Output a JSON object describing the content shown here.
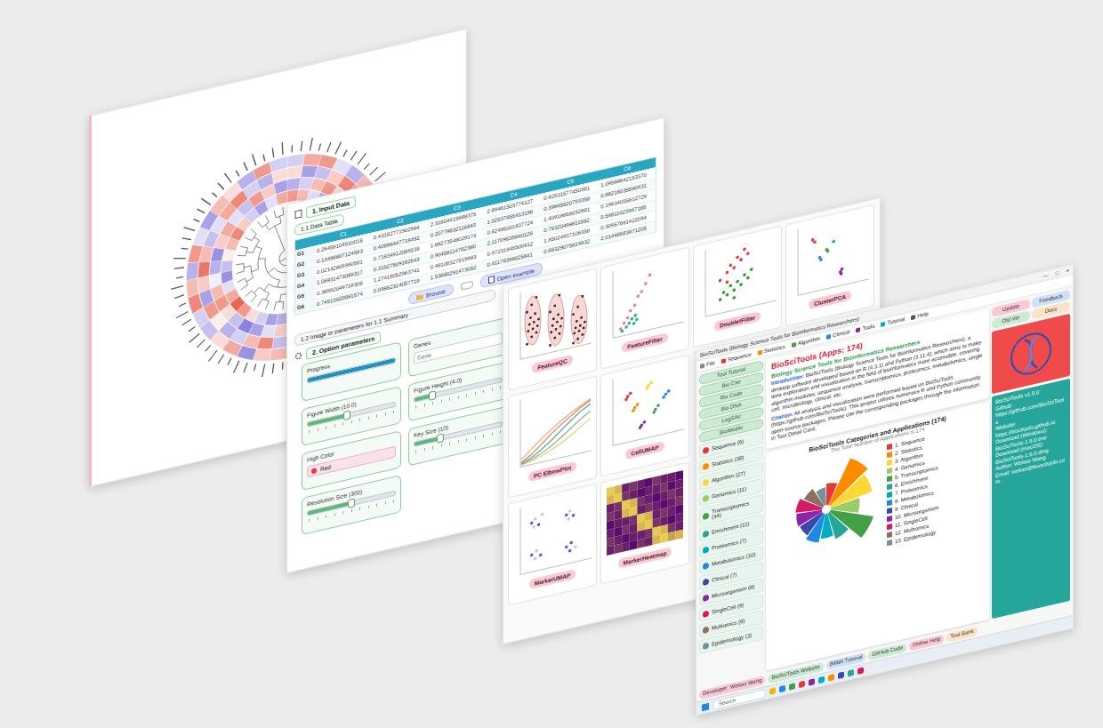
{
  "heatmap_window": {
    "rings": [
      [
        0.6,
        0.4,
        -0.2,
        -0.5,
        -0.7,
        -0.3,
        0.1,
        0.5,
        0.8,
        0.6,
        -0.4,
        -0.6,
        -0.8,
        -0.2,
        0.3,
        0.7,
        0.4,
        -0.1,
        -0.5,
        -0.6,
        -0.3,
        0.2,
        0.6,
        0.9,
        0.5,
        -0.2,
        -0.7,
        -0.4,
        0.1,
        0.4,
        0.7,
        0.3,
        -0.3,
        -0.6,
        -0.2,
        0.5
      ],
      [
        -0.5,
        -0.3,
        0.4,
        0.6,
        0.2,
        -0.4,
        -0.7,
        -0.5,
        0.3,
        0.5,
        0.7,
        0.2,
        -0.3,
        -0.6,
        -0.4,
        0.1,
        0.5,
        0.8,
        0.3,
        -0.2,
        -0.6,
        -0.8,
        -0.4,
        0.2,
        0.6,
        0.4,
        -0.1,
        -0.5,
        -0.7,
        0.3,
        0.5,
        -0.2,
        -0.4,
        0.6,
        0.3,
        -0.6
      ],
      [
        0.2,
        -0.6,
        -0.4,
        0.3,
        0.7,
        0.5,
        -0.2,
        -0.4,
        -0.6,
        0.4,
        0.2,
        -0.5,
        0.6,
        0.3,
        -0.7,
        -0.3,
        0.2,
        0.5,
        -0.4,
        0.7,
        0.4,
        -0.3,
        -0.5,
        0.1,
        0.6,
        -0.6,
        0.3,
        0.8,
        0.4,
        -0.4,
        -0.2,
        0.5,
        0.7,
        -0.3,
        -0.5,
        0.2
      ],
      [
        -0.3,
        0.5,
        0.6,
        -0.2,
        -0.5,
        0.4,
        0.3,
        -0.6,
        -0.2,
        0.7,
        -0.4,
        0.3,
        0.5,
        -0.6,
        -0.3,
        0.6,
        -0.5,
        -0.2,
        0.4,
        0.3,
        -0.7,
        0.5,
        0.2,
        -0.4,
        -0.3,
        0.7,
        0.4,
        -0.5,
        0.6,
        -0.2,
        -0.6,
        0.4,
        0.2,
        -0.5,
        0.6,
        -0.3
      ]
    ]
  },
  "data_window": {
    "section1": "1. Input Data",
    "subsection": "1.1 Data Table",
    "table": {
      "columns": [
        "C1",
        "C2",
        "C3",
        "C4",
        "C5",
        "C6"
      ],
      "rows": [
        {
          "name": "G1",
          "cells": [
            "0.28458104510016",
            "0.43182771902984",
            "2.31604419988375",
            "2.69461503774127",
            "0.82531577450361",
            "1.09588642153370"
          ]
        },
        {
          "name": "G2",
          "cells": [
            "0.13498807124563",
            "0.40898447718492",
            "0.20779632116843",
            "1.02637855413196",
            "0.39845520793358",
            "0.86216035590431"
          ]
        },
        {
          "name": "G3",
          "cells": [
            "0.02142805990561",
            "0.71834912065539",
            "1.68273548029174",
            "0.62495001837724",
            "1.40918856032861",
            "0.19834055612729"
          ]
        },
        {
          "name": "G4",
          "cells": [
            "1.06931473089317",
            "0.31527509182643",
            "0.90458114762380",
            "2.11709635840128",
            "0.75320498811562",
            "0.54811023947165"
          ]
        },
        {
          "name": "G5",
          "cells": [
            "0.36592049718306",
            "1.27418052963741",
            "0.48106327519983",
            "0.97231845500612",
            "1.85024937106358",
            "0.30957681422094"
          ]
        },
        {
          "name": "G6",
          "cells": [
            "0.74513920681574",
            "0.09862314057719",
            "1.53680291473052",
            "0.41176398025841",
            "0.66329075814932",
            "2.01448563971205"
          ]
        }
      ]
    },
    "buttons": [
      "Browse",
      "Open example"
    ],
    "summary_bar": "1.2 Image or parameters for 1.1 Summary",
    "section2": "2. Option parameters",
    "options": [
      {
        "kind": "progress",
        "label": "Progress",
        "level": 1.0
      },
      {
        "kind": "text",
        "label": "Genes",
        "placeholder": "Gene"
      },
      {
        "kind": "slider",
        "label": "Figure Width (10.0)",
        "level": 0.45
      },
      {
        "kind": "slider",
        "label": "Figure Height (4.0)",
        "level": 0.2
      },
      {
        "kind": "select",
        "label": "High Color",
        "value": "Red",
        "color": "#e53935"
      },
      {
        "kind": "slider",
        "label": "Key Size (10)",
        "level": 0.3
      },
      {
        "kind": "slider",
        "label": "Resolution Size (300)",
        "level": 0.5
      }
    ]
  },
  "plots_window": {
    "plots": [
      {
        "label": "FeatureQC",
        "kind": "violin",
        "series": [
          [
            2,
            3,
            3.5,
            4,
            4.2,
            4.5,
            5,
            5.2,
            5.5,
            6,
            6.5,
            7,
            8,
            9
          ],
          [
            1,
            2,
            2.5,
            3,
            3.3,
            3.6,
            4,
            4.4,
            4.8,
            5,
            5.5,
            6.2,
            7,
            8.5
          ],
          [
            0.5,
            1,
            1.5,
            2,
            2.2,
            2.5,
            2.8,
            3,
            3.4,
            3.8,
            4.2,
            5,
            6,
            7.5
          ]
        ]
      },
      {
        "label": "FeatureFilter",
        "kind": "scatter",
        "colors": [
          "#f08080",
          "#1fb5a0"
        ],
        "points": [
          [
            1,
            1,
            0
          ],
          [
            1.5,
            1.8,
            0
          ],
          [
            2,
            2.5,
            0
          ],
          [
            2.4,
            3.5,
            0
          ],
          [
            3,
            4.2,
            0
          ],
          [
            3.5,
            5.5,
            0
          ],
          [
            4,
            6.1,
            0
          ],
          [
            4.6,
            7.2,
            0
          ],
          [
            5.2,
            8.4,
            0
          ],
          [
            1.2,
            0.6,
            1
          ],
          [
            1.8,
            1.1,
            1
          ],
          [
            2.2,
            1.6,
            1
          ],
          [
            2.6,
            2.2,
            1
          ],
          [
            3.1,
            2.6,
            1
          ],
          [
            3.3,
            1.9,
            1
          ],
          [
            2.9,
            1.4,
            1
          ]
        ]
      },
      {
        "label": "DoubletFilter",
        "kind": "scatter",
        "colors": [
          "#e53935",
          "#2e9e2e"
        ],
        "points": [
          [
            2,
            5,
            0
          ],
          [
            3,
            6,
            0
          ],
          [
            3.5,
            7,
            0
          ],
          [
            4,
            6.5,
            0
          ],
          [
            4.5,
            8,
            0
          ],
          [
            5,
            7.5,
            0
          ],
          [
            5.5,
            9,
            0
          ],
          [
            6,
            8.2,
            0
          ],
          [
            3,
            4.5,
            0
          ],
          [
            2,
            2,
            1
          ],
          [
            2.5,
            3,
            1
          ],
          [
            3,
            2.5,
            1
          ],
          [
            3.5,
            3.8,
            1
          ],
          [
            4,
            3,
            1
          ],
          [
            4.5,
            4.2,
            1
          ],
          [
            5,
            3.6,
            1
          ],
          [
            5.5,
            5,
            1
          ],
          [
            6,
            4.4,
            1
          ],
          [
            6.5,
            5.6,
            1
          ],
          [
            4,
            1.8,
            1
          ]
        ]
      },
      {
        "label": "ClusterPCA",
        "kind": "scatter",
        "colors": [
          "#e53935",
          "#43a047",
          "#1e88e5",
          "#8e24aa",
          "#00acc1"
        ],
        "points": [
          [
            2,
            8,
            0
          ],
          [
            2.3,
            7.6,
            0
          ],
          [
            4,
            6,
            1
          ],
          [
            4.2,
            5.7,
            1
          ],
          [
            3,
            5,
            2
          ],
          [
            3.2,
            4.6,
            2
          ],
          [
            6,
            2,
            3
          ],
          [
            6.2,
            2.4,
            3
          ],
          [
            6.1,
            1.7,
            3
          ],
          [
            5,
            7,
            4
          ]
        ]
      },
      {
        "label": "PC ElbowPlot",
        "kind": "lines",
        "colors": [
          "#f4a261",
          "#e76f51",
          "#2a9d8f",
          "#8ab17d",
          "#e9c46a"
        ],
        "series": [
          [
            1,
            2.2,
            3.5,
            4.6,
            5.6,
            6.5,
            7.3,
            8.0
          ],
          [
            0.5,
            1.4,
            2.6,
            3.9,
            5.0,
            6.0,
            7.0,
            7.8
          ],
          [
            0.3,
            0.9,
            1.8,
            2.9,
            4.1,
            5.3,
            6.4,
            7.2
          ],
          [
            0.2,
            0.6,
            1.2,
            2.0,
            3.0,
            4.1,
            5.2,
            6.1
          ],
          [
            0.1,
            0.4,
            0.8,
            1.4,
            2.1,
            3.0,
            4.0,
            4.9
          ]
        ]
      },
      {
        "label": "CellUMAP",
        "kind": "scatter",
        "colors": [
          "#e53935",
          "#fb8c00",
          "#fdd835",
          "#43a047",
          "#1e88e5",
          "#8e24aa"
        ],
        "points": [
          [
            2,
            7,
            0
          ],
          [
            2.4,
            7.4,
            0
          ],
          [
            1.8,
            6.6,
            0
          ],
          [
            3,
            5,
            1
          ],
          [
            3.4,
            5.4,
            1
          ],
          [
            2.8,
            4.6,
            1
          ],
          [
            5,
            8,
            2
          ],
          [
            5.4,
            8.3,
            2
          ],
          [
            4.8,
            7.6,
            2
          ],
          [
            6,
            4,
            3
          ],
          [
            6.4,
            4.5,
            3
          ],
          [
            5.8,
            3.6,
            3
          ],
          [
            7.5,
            6,
            4
          ],
          [
            7.9,
            6.4,
            4
          ],
          [
            7.2,
            5.6,
            4
          ],
          [
            4,
            2,
            5
          ],
          [
            4.4,
            2.4,
            5
          ],
          [
            3.8,
            1.7,
            5
          ]
        ]
      },
      {
        "label": "MarkerUMAP",
        "kind": "scatter",
        "colors": [
          "#6a5acd",
          "#c8c8e8"
        ],
        "points": [
          [
            1.5,
            7.5,
            0
          ],
          [
            2,
            8,
            1
          ],
          [
            2.5,
            7,
            0
          ],
          [
            3,
            8.5,
            1
          ],
          [
            1.8,
            6.8,
            1
          ],
          [
            6.5,
            7.5,
            0
          ],
          [
            7,
            8,
            1
          ],
          [
            7.5,
            7.2,
            0
          ],
          [
            6.8,
            6.8,
            1
          ],
          [
            1.5,
            2.5,
            0
          ],
          [
            2.2,
            3,
            1
          ],
          [
            2.8,
            2.2,
            0
          ],
          [
            2,
            1.8,
            1
          ],
          [
            6.5,
            2.5,
            0
          ],
          [
            7.2,
            3,
            0
          ],
          [
            7.8,
            2.2,
            1
          ],
          [
            7,
            1.8,
            0
          ]
        ]
      },
      {
        "label": "MarkerHeatmap",
        "kind": "heatmap",
        "matrix": [
          [
            0.9,
            0.8,
            0.1,
            0.2,
            0.1,
            0.0,
            0.2,
            0.1,
            0.1,
            0.0
          ],
          [
            0.8,
            0.9,
            0.2,
            0.1,
            0.0,
            0.1,
            0.1,
            0.2,
            0.0,
            0.1
          ],
          [
            0.1,
            0.2,
            0.9,
            0.8,
            0.2,
            0.1,
            0.0,
            0.1,
            0.2,
            0.1
          ],
          [
            0.2,
            0.1,
            0.8,
            0.9,
            0.1,
            0.2,
            0.1,
            0.0,
            0.1,
            0.2
          ],
          [
            0.0,
            0.1,
            0.1,
            0.2,
            0.9,
            0.8,
            0.1,
            0.2,
            0.1,
            0.0
          ],
          [
            0.1,
            0.0,
            0.2,
            0.1,
            0.8,
            0.9,
            0.2,
            0.1,
            0.0,
            0.1
          ],
          [
            0.2,
            0.1,
            0.0,
            0.1,
            0.1,
            0.2,
            0.9,
            0.8,
            0.2,
            0.1
          ],
          [
            0.1,
            0.2,
            0.1,
            0.0,
            0.2,
            0.1,
            0.8,
            0.9,
            0.7,
            0.8
          ]
        ]
      }
    ]
  },
  "app_window": {
    "title": "BioSciTools (Biology Science Tools for Bioinformatics Researchers)",
    "controls": [
      "—",
      "□",
      "×"
    ],
    "menu": [
      "File",
      "Sequence",
      "Statistics",
      "Algorithm",
      "Clinical",
      "Tools",
      "Tutorial",
      "Help"
    ],
    "sidebar_buttons": [
      "Tool Tutorial",
      "Bio Cite",
      "Bio Code",
      "Bio DNA",
      "LogSAV",
      "BioMedAI"
    ],
    "categories": [
      {
        "label": "Sequence (5)",
        "legend": "1. Sequence",
        "count": 5,
        "color": "#e53935"
      },
      {
        "label": "Statistics (36)",
        "legend": "2. Statistics",
        "count": 36,
        "color": "#fb8c00"
      },
      {
        "label": "Algorithm (27)",
        "legend": "3. Algorithm",
        "count": 27,
        "color": "#fdd835"
      },
      {
        "label": "Genomics (11)",
        "legend": "4. Genomics",
        "count": 11,
        "color": "#9ccc65"
      },
      {
        "label": "Transcriptomics (34)",
        "legend": "5. Transcriptomics",
        "count": 34,
        "color": "#43a047"
      },
      {
        "label": "Enrichment (11)",
        "legend": "6. Enrichment",
        "count": 11,
        "color": "#26a69a"
      },
      {
        "label": "Proteomics (7)",
        "legend": "7. Proteomics",
        "count": 7,
        "color": "#00acc1"
      },
      {
        "label": "Metabolomics (10)",
        "legend": "8. Metabolomics",
        "count": 10,
        "color": "#1e88e5"
      },
      {
        "label": "Clinical (7)",
        "legend": "9. Clinical",
        "count": 7,
        "color": "#3949ab"
      },
      {
        "label": "Microorganism (8)",
        "legend": "10. Microorganism",
        "count": 8,
        "color": "#8e24aa"
      },
      {
        "label": "SingleCell (9)",
        "legend": "11. SingleCell",
        "count": 9,
        "color": "#d81b60"
      },
      {
        "label": "Multiomics (6)",
        "legend": "12. Multiomics",
        "count": 6,
        "color": "#8d6e63"
      },
      {
        "label": "Epidemiology (3)",
        "legend": "13. Epidemiology",
        "count": 3,
        "color": "#78909c"
      }
    ],
    "intro": {
      "title": "BioSciTools (Apps: 174)",
      "subtitle": "Biology Science Tools for Bioinformatics Researchers",
      "intro_label": "Introduction:",
      "intro_text": "BioSciTools (Biology Science Tools for Bioinformatics Researchers), a desktop software developed based on R (4.3.1) and Python (3.11.4), which aims to make data exploration and visualization in the field of bioinformatics more accessible, covering algorithm modules, sequence analysis, transcriptomics, proteomics, metabolomics, single cell, microbiology, clinical, etc.",
      "cite_label": "Citation:",
      "cite_text": "All analysis and visualization were performed based on BioSciTools (https://github.com/BioSciTools). This project utilizes numerous R and Python community open-source packages. Please cite the corresponding packages through the information in Tool Detail Card."
    },
    "chart": {
      "title": "BioSciTools Categories and Applications (174)",
      "subtitle": "The Total Number of Applications is 174"
    },
    "right_buttons": [
      {
        "label": "Update",
        "color": "#f9c9d6"
      },
      {
        "label": "Feedback",
        "color": "#cfe0fb"
      },
      {
        "label": "Old Ver",
        "color": "#cdebd3"
      },
      {
        "label": "Docs",
        "color": "#fde3c6"
      }
    ],
    "info": [
      "BioSciTools v1.5.0",
      "Github:",
      "https://github.com/BioSciTools",
      "Website:",
      "https://biscitools.github.io",
      "Download (Windows):",
      "BioSciTools-1.5.0.exe",
      "Download (macOS):",
      "BioSciTools-1.5.0.dmg",
      "Author: Weitao Wang",
      "Email: weitao@bioscitools.com"
    ],
    "footer": [
      {
        "label": "Developer: Weitao Wang",
        "color": "#f9c9d6"
      },
      {
        "label": "BioSciTools Website",
        "color": "#cdebd3"
      },
      {
        "label": "Bilibili Tutorial",
        "color": "#cfe0fb"
      },
      {
        "label": "GitHub Code",
        "color": "#cdebd3"
      },
      {
        "label": "Online Help",
        "color": "#f9c9d6"
      },
      {
        "label": "Tool Bank",
        "color": "#fde3c6"
      }
    ],
    "taskbar": {
      "search": "Search"
    }
  }
}
